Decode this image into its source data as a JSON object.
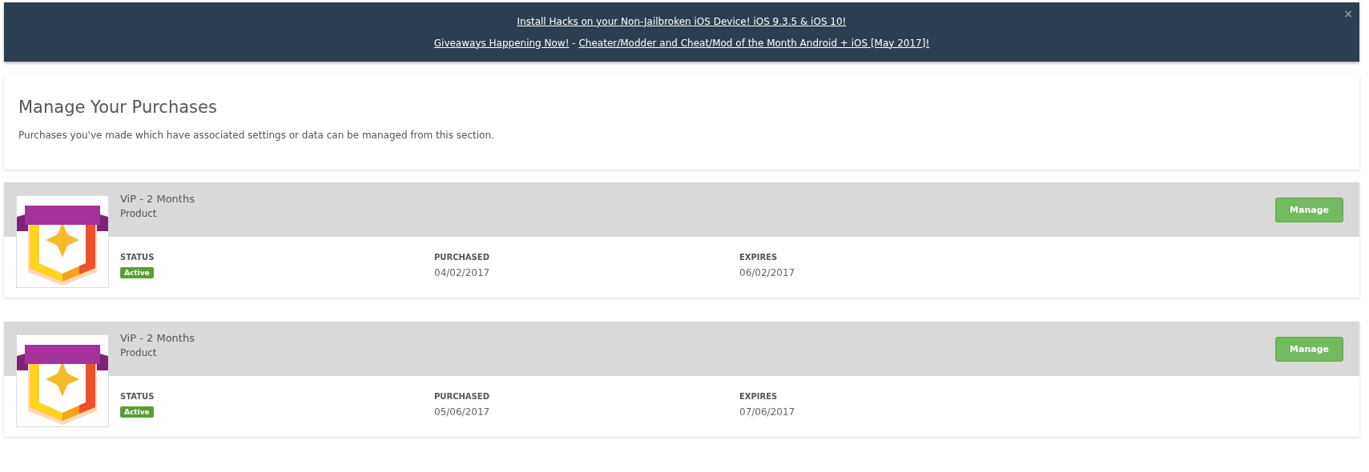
{
  "banner": {
    "lines": [
      [
        {
          "kind": "link",
          "text": "Install Hacks on your Non-Jailbroken iOS Device! iOS 9.3.5 & iOS 10!"
        }
      ],
      [
        {
          "kind": "link",
          "text": "Giveaways Happening Now!"
        },
        {
          "kind": "text",
          "text": " - "
        },
        {
          "kind": "link",
          "text": "Cheater/Modder and Cheat/Mod of the Month Android + iOS [May 2017]!"
        }
      ]
    ],
    "close": "×"
  },
  "header": {
    "title": "Manage Your Purchases",
    "description": "Purchases you've made which have associated settings or data can be managed from this section."
  },
  "purchases": [
    {
      "name": "ViP - 2 Months",
      "type": "Product",
      "button": "Manage",
      "status_label": "STATUS",
      "status": "Active",
      "purchased_label": "PURCHASED",
      "purchased": "04/02/2017",
      "expires_label": "EXPIRES",
      "expires": "06/02/2017"
    },
    {
      "name": "ViP - 2 Months",
      "type": "Product",
      "button": "Manage",
      "status_label": "STATUS",
      "status": "Active",
      "purchased_label": "PURCHASED",
      "purchased": "05/06/2017",
      "expires_label": "EXPIRES",
      "expires": "07/06/2017"
    }
  ]
}
